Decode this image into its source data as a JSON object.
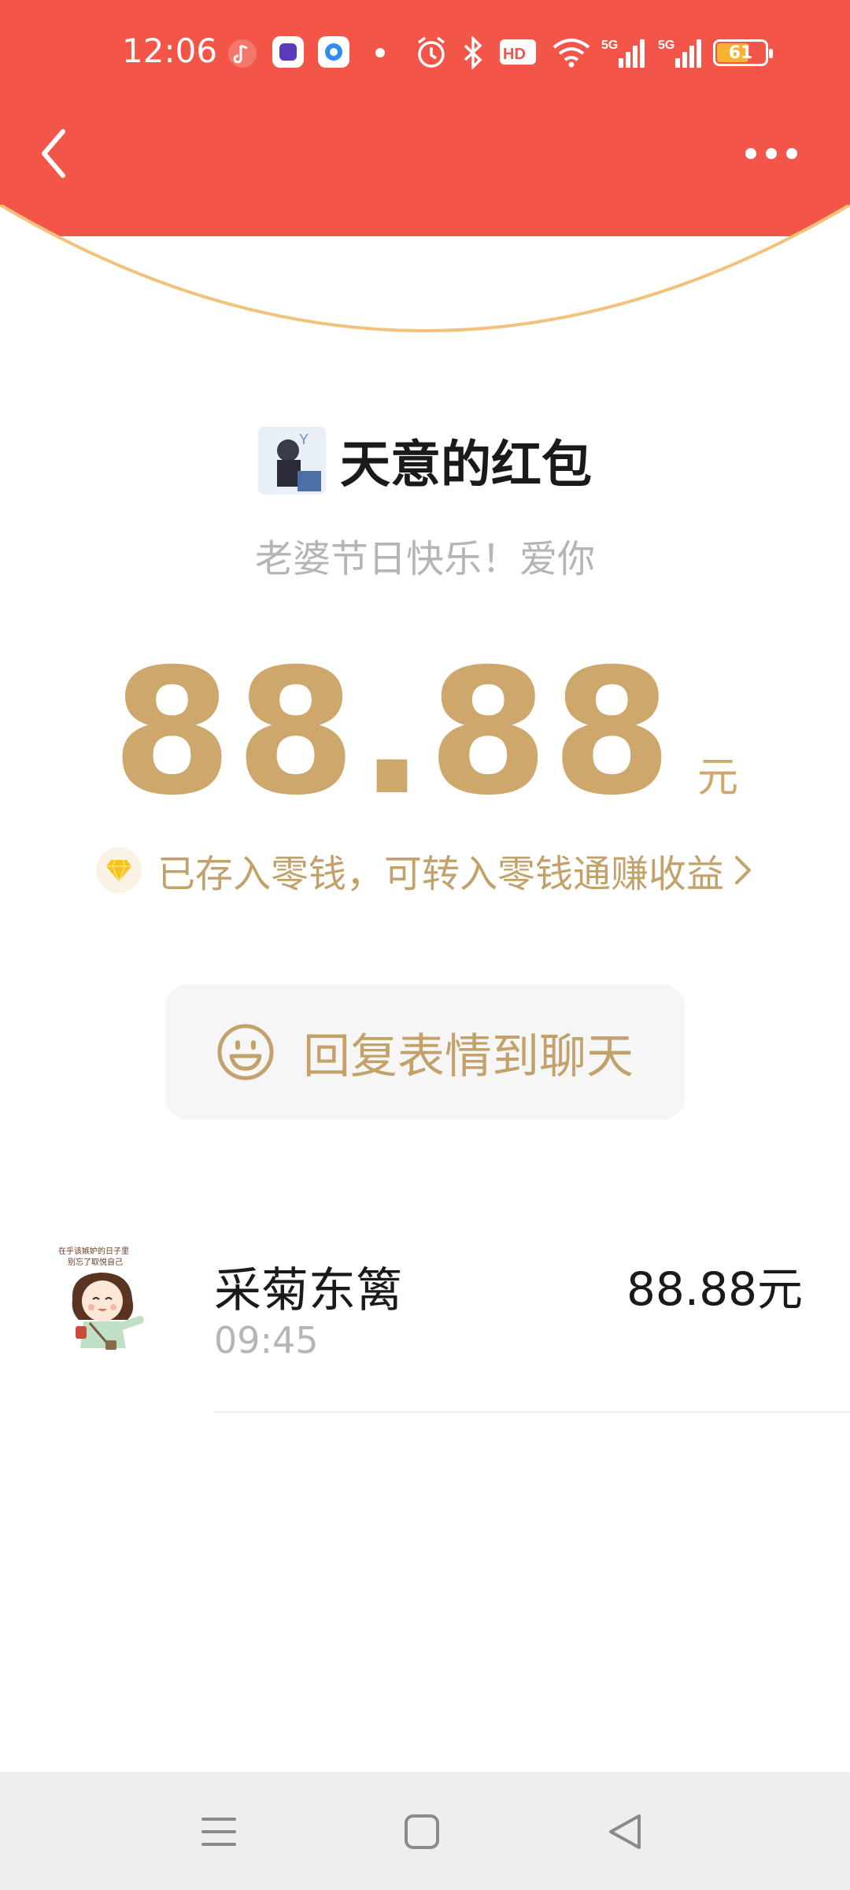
{
  "status_bar": {
    "time": "12:06",
    "battery": "61",
    "network": "5G"
  },
  "header": {
    "back_icon": "chevron-left-icon",
    "more_icon": "more-horizontal-icon"
  },
  "packet": {
    "sender_title": "天意的红包",
    "blessing": "老婆节日快乐！爱你",
    "amount": "88.88",
    "unit": "元",
    "saved_text": "已存入零钱，可转入零钱通赚收益"
  },
  "reply": {
    "label": "回复表情到聊天"
  },
  "record": {
    "avatar_caption_1": "在乎该嫉妒的日子里",
    "avatar_caption_2": "别忘了取悦自己",
    "name": "采菊东篱",
    "time": "09:45",
    "amount": "88.88元"
  },
  "colors": {
    "header_red": "#f35548",
    "gold": "#cda76c",
    "gold_text": "#c3a16a"
  }
}
